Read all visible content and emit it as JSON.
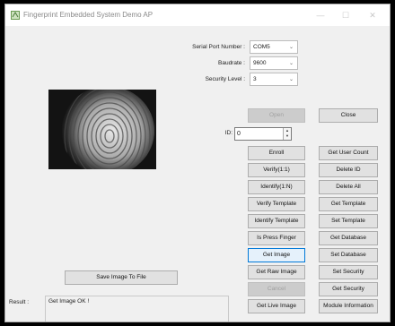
{
  "window": {
    "title": "Fingerprint Embedded System Demo AP",
    "minimize": "—",
    "maximize": "☐",
    "close": "✕"
  },
  "settings": {
    "serial_port_label": "Serial Port Number :",
    "serial_port_value": "COM5",
    "baudrate_label": "Baudrate :",
    "baudrate_value": "9600",
    "security_label": "Security Level :",
    "security_value": "3"
  },
  "buttons": {
    "open": "Open",
    "close": "Close",
    "save_image": "Save Image To File"
  },
  "id_field": {
    "label": "ID:",
    "value": "0"
  },
  "commands": {
    "left": [
      "Enroll",
      "Verify(1:1)",
      "Identify(1:N)",
      "Verify Template",
      "Identify Template",
      "Is Press Finger",
      "Get Image",
      "Get Raw Image",
      "Cancel",
      "Get Live Image"
    ],
    "right": [
      "Get User Count",
      "Delete ID",
      "Delete All",
      "Get Template",
      "Set Template",
      "Get Database",
      "Set Database",
      "Set Security",
      "Get Security",
      "Module Information"
    ]
  },
  "result": {
    "label": "Result :",
    "text": "Get Image OK !"
  },
  "icons": {
    "app": "fingerprint-app-icon",
    "dropdown": "chevron-down-icon",
    "spin": "spin-buttons-icon"
  }
}
